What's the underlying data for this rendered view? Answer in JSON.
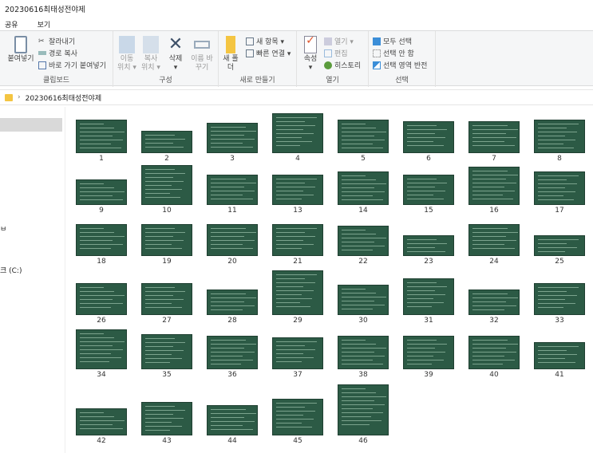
{
  "window": {
    "title": "20230616최태성전야제"
  },
  "tabs": [
    "공유",
    "보기"
  ],
  "ribbon": {
    "clipboard": {
      "label": "클립보드",
      "paste": "붙여넣기",
      "cut": "잘라내기",
      "copy_path": "경로 복사",
      "paste_shortcut": "바로 가기 붙여넣기"
    },
    "organize": {
      "label": "구성",
      "move_to": "이동 위치 ▾",
      "copy_to": "복사 위치 ▾",
      "delete": "삭제",
      "delete_arrow": "▾",
      "rename": "이름 바꾸기"
    },
    "new": {
      "label": "새로 만들기",
      "new_folder": "새 폴더",
      "new_item": "새 항목 ▾",
      "easy_access": "빠른 연결 ▾"
    },
    "open": {
      "label": "열기",
      "properties": "속성",
      "properties_arrow": "▾",
      "open": "열기 ▾",
      "edit": "편집",
      "history": "히스토리"
    },
    "select": {
      "label": "선택",
      "select_all": "모두 선택",
      "select_none": "선택 안 함",
      "invert": "선택 영역 반전"
    }
  },
  "address": {
    "sep": "›",
    "path": "20230616최태성전야제"
  },
  "sidebar": {
    "items": [
      "ㅂ",
      "크 (C:)"
    ]
  },
  "files": [
    "1",
    "2",
    "3",
    "4",
    "5",
    "6",
    "7",
    "8",
    "9",
    "10",
    "11",
    "13",
    "14",
    "15",
    "16",
    "17",
    "18",
    "19",
    "20",
    "21",
    "22",
    "23",
    "24",
    "25",
    "26",
    "27",
    "28",
    "29",
    "30",
    "31",
    "32",
    "33",
    "34",
    "35",
    "36",
    "37",
    "38",
    "39",
    "40",
    "41",
    "42",
    "43",
    "44",
    "45",
    "46"
  ],
  "colors": {
    "thumb_bg": "#2c5a45",
    "accent": "#0078d7"
  }
}
